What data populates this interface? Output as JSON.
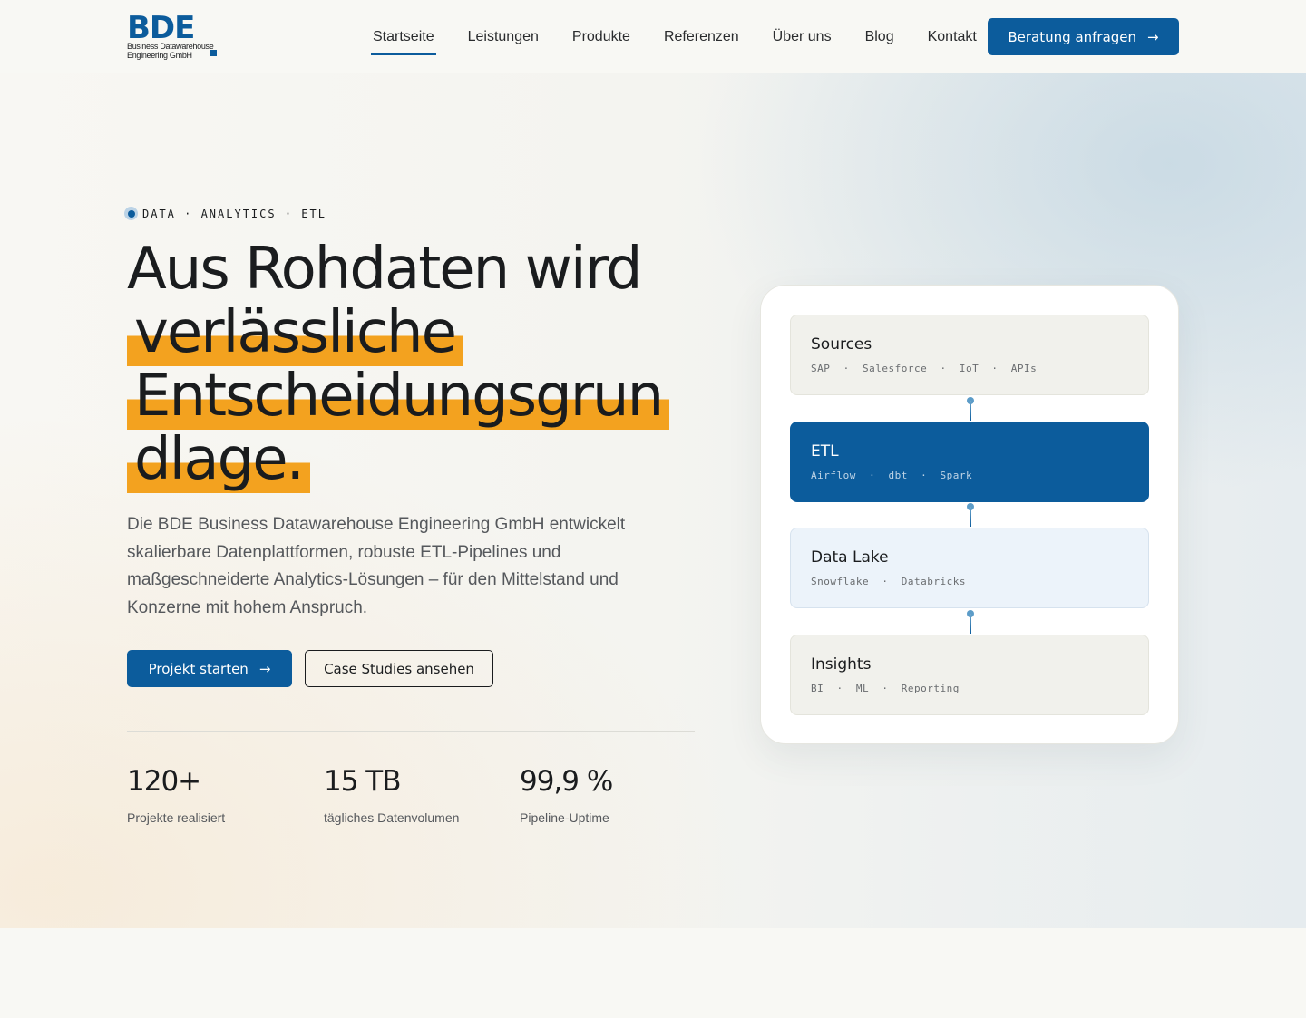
{
  "header": {
    "logo": {
      "letters": "BDE",
      "line1": "Business Datawarehouse",
      "line2": "Engineering GmbH"
    },
    "nav": [
      {
        "label": "Startseite",
        "active": true
      },
      {
        "label": "Leistungen"
      },
      {
        "label": "Produkte"
      },
      {
        "label": "Referenzen"
      },
      {
        "label": "Über uns"
      },
      {
        "label": "Blog"
      },
      {
        "label": "Kontakt"
      }
    ],
    "cta": {
      "label": "Beratung anfragen",
      "arrow": "→"
    }
  },
  "hero": {
    "eyebrow": "DATA · ANALYTICS · ETL",
    "headline": {
      "line1": "Aus Rohdaten wird",
      "hl1": "verlässliche",
      "hl2": "Entscheidungsgrun",
      "hl3": "dlage."
    },
    "lead": "Die BDE Business Datawarehouse Engineering GmbH entwickelt skalierbare Datenplattformen, robuste ETL-Pipelines und maßgeschneiderte Analytics-Lösungen – für den Mittelstand und Konzerne mit hohem Anspruch.",
    "primary_button": {
      "label": "Projekt starten",
      "arrow": "→"
    },
    "secondary_button": {
      "label": "Case Studies ansehen"
    },
    "stats": [
      {
        "value": "120+",
        "label": "Projekte realisiert"
      },
      {
        "value": "15 TB",
        "label": "tägliches Datenvolumen"
      },
      {
        "value": "99,9 %",
        "label": "Pipeline-Uptime"
      }
    ]
  },
  "pipeline": {
    "stages": [
      {
        "title": "Sources",
        "tags": "SAP  ·  Salesforce  ·  IoT  ·  APIs"
      },
      {
        "title": "ETL",
        "tags": "Airflow  ·  dbt  ·  Spark"
      },
      {
        "title": "Data Lake",
        "tags": "Snowflake  ·  Databricks"
      },
      {
        "title": "Insights",
        "tags": "BI  ·  ML  ·  Reporting"
      }
    ]
  },
  "colors": {
    "brand": "#0c5c9c",
    "highlight": "#f3a21f",
    "background": "#f8f8f4",
    "text": "#1a1c1e"
  }
}
